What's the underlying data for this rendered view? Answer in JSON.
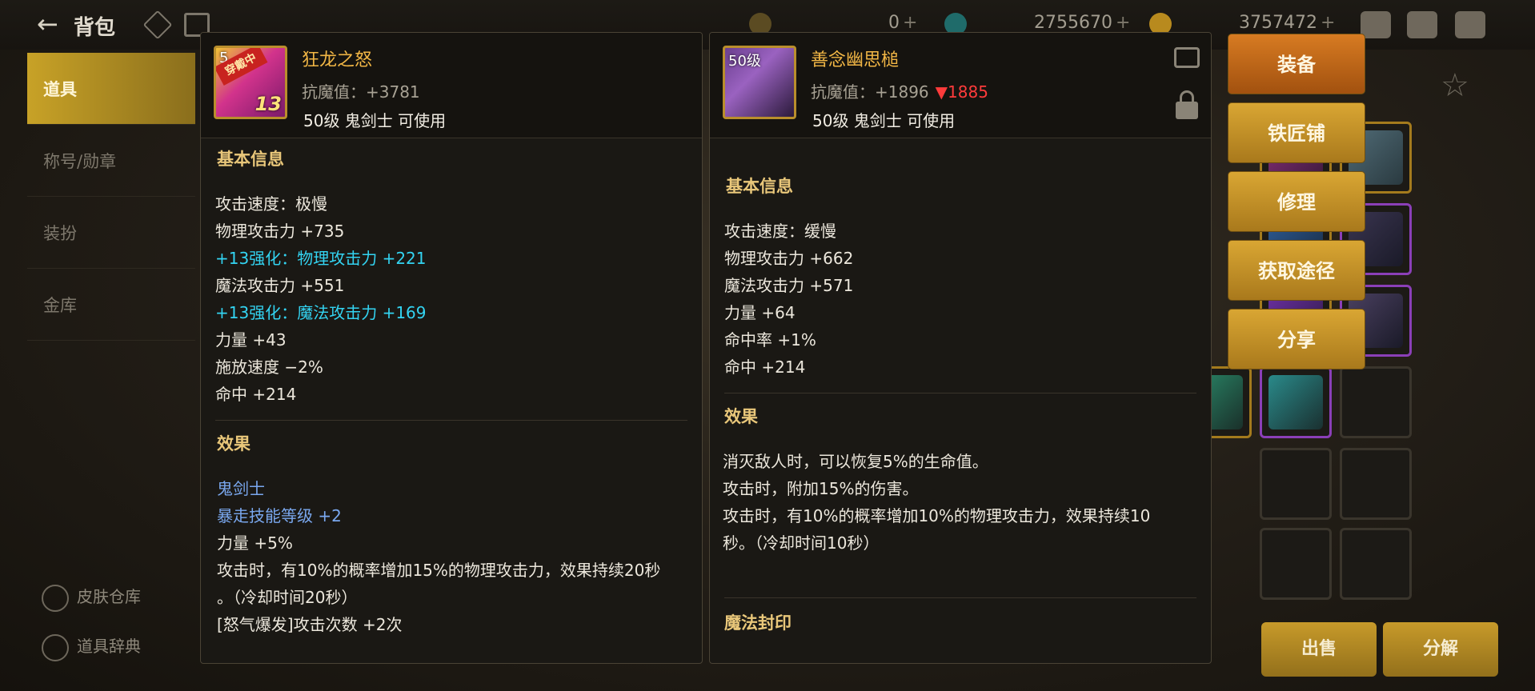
{
  "topbar": {
    "title": "背包",
    "currency1": "0",
    "currency2": "2755670",
    "currency3": "3757472",
    "plus": "+"
  },
  "sidebar": {
    "items": [
      {
        "label": "道具",
        "active": true
      },
      {
        "label": "称号/勋章",
        "active": false
      },
      {
        "label": "装扮",
        "active": false
      },
      {
        "label": "金库",
        "active": false
      }
    ],
    "bottom": [
      {
        "label": "皮肤仓库"
      },
      {
        "label": "道具辞典"
      }
    ]
  },
  "left_item": {
    "level_badge": "5",
    "equipped_badge": "穿戴中",
    "enhance": "13",
    "name": "狂龙之怒",
    "anti_magic": "抗魔值：+3781",
    "usable": "50级 鬼剑士 可使用",
    "basic_title": "基本信息",
    "basic": [
      {
        "text": "攻击速度：极慢",
        "style": "normal"
      },
      {
        "text": "物理攻击力 +735",
        "style": "normal"
      },
      {
        "text": "+13强化：物理攻击力 +221",
        "style": "cyan"
      },
      {
        "text": "魔法攻击力 +551",
        "style": "normal"
      },
      {
        "text": "+13强化：魔法攻击力 +169",
        "style": "cyan"
      },
      {
        "text": "力量 +43",
        "style": "normal"
      },
      {
        "text": "施放速度 −2%",
        "style": "normal"
      },
      {
        "text": "命中 +214",
        "style": "normal"
      }
    ],
    "effect_title": "效果",
    "effects": [
      {
        "text": "鬼剑士",
        "style": "blue"
      },
      {
        "text": "暴走技能等级 +2",
        "style": "blue"
      },
      {
        "text": "力量 +5%",
        "style": "normal"
      },
      {
        "text": "攻击时，有10%的概率增加15%的物理攻击力，效果持续20秒",
        "style": "normal"
      },
      {
        "text": "。（冷却时间20秒）",
        "style": "normal"
      },
      {
        "text": "[怒气爆发]攻击次数 +2次",
        "style": "normal"
      }
    ]
  },
  "right_item": {
    "level_badge": "50级",
    "name": "善念幽思槌",
    "anti_magic": "抗魔值：+1896",
    "anti_diff": "▼1885",
    "usable": "50级 鬼剑士 可使用",
    "basic_title": "基本信息",
    "basic": [
      {
        "text": "攻击速度：缓慢"
      },
      {
        "text": "物理攻击力 +662"
      },
      {
        "text": "魔法攻击力 +571"
      },
      {
        "text": "力量 +64"
      },
      {
        "text": "命中率 +1%"
      },
      {
        "text": "命中 +214"
      }
    ],
    "effect_title": "效果",
    "effects": [
      {
        "text": "消灭敌人时，可以恢复5%的生命值。"
      },
      {
        "text": "攻击时，附加15%的伤害。"
      },
      {
        "text": "攻击时，有10%的概率增加10%的物理攻击力，效果持续10"
      },
      {
        "text": "秒。（冷却时间10秒）"
      }
    ],
    "seal_title": "魔法封印"
  },
  "actions": [
    "装备",
    "铁匠铺",
    "修理",
    "获取途径",
    "分享"
  ],
  "bottom_buttons": {
    "sell": "出售",
    "decompose": "分解"
  }
}
